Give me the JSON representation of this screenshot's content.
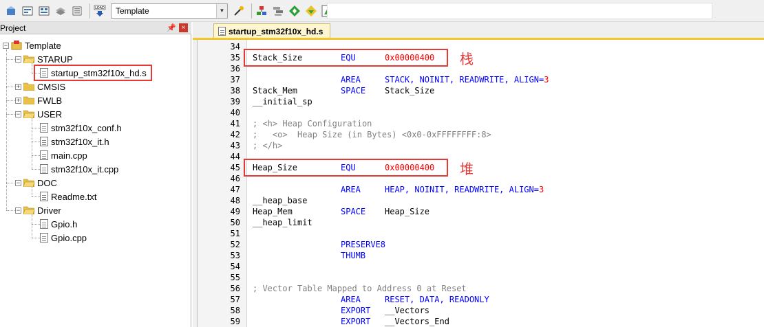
{
  "toolbar": {
    "target_combo": "Template",
    "icons": [
      "manage-components-icon",
      "options-icon",
      "options-alt-icon",
      "pack-icon",
      "batch-icon",
      "load-icon",
      "wizard-icon",
      "component-red-icon",
      "event-icon",
      "green-diamond-icon",
      "yellow-diamond-icon",
      "tree-icon"
    ]
  },
  "project": {
    "title": "Project",
    "root": "Template",
    "groups": [
      {
        "name": "STARUP",
        "expanded": true,
        "files": [
          "startup_stm32f10x_hd.s"
        ]
      },
      {
        "name": "CMSIS",
        "expanded": false,
        "files": []
      },
      {
        "name": "FWLB",
        "expanded": false,
        "files": []
      },
      {
        "name": "USER",
        "expanded": true,
        "files": [
          "stm32f10x_conf.h",
          "stm32f10x_it.h",
          "main.cpp",
          "stm32f10x_it.cpp"
        ]
      },
      {
        "name": "DOC",
        "expanded": true,
        "files": [
          "Readme.txt"
        ]
      },
      {
        "name": "Driver",
        "expanded": true,
        "files": [
          "Gpio.h",
          "Gpio.cpp"
        ]
      }
    ]
  },
  "editor": {
    "tab": "startup_stm32f10x_hd.s",
    "lines": [
      {
        "n": "34"
      },
      {
        "n": "35",
        "c1": "Stack_Size",
        "c2": "EQU",
        "hex": "0x00000400"
      },
      {
        "n": "36"
      },
      {
        "n": "37",
        "c2": "AREA",
        "c3a": "STACK, NOINIT, READWRITE, ALIGN=",
        "num": "3"
      },
      {
        "n": "38",
        "c1": "Stack_Mem",
        "c2": "SPACE",
        "c3": "Stack_Size"
      },
      {
        "n": "39",
        "c1": "__initial_sp"
      },
      {
        "n": "40"
      },
      {
        "n": "41",
        "cm": "; <h> Heap Configuration"
      },
      {
        "n": "42",
        "cm": ";   <o>  Heap Size (in Bytes) <0x0-0xFFFFFFFF:8>"
      },
      {
        "n": "43",
        "cm": "; </h>"
      },
      {
        "n": "44"
      },
      {
        "n": "45",
        "c1": "Heap_Size",
        "c2": "EQU",
        "hex": "0x00000400"
      },
      {
        "n": "46"
      },
      {
        "n": "47",
        "c2": "AREA",
        "c3a": "HEAP, NOINIT, READWRITE, ALIGN=",
        "num": "3"
      },
      {
        "n": "48",
        "c1": "__heap_base"
      },
      {
        "n": "49",
        "c1": "Heap_Mem",
        "c2": "SPACE",
        "c3": "Heap_Size"
      },
      {
        "n": "50",
        "c1": "__heap_limit"
      },
      {
        "n": "51"
      },
      {
        "n": "52",
        "c2": "PRESERVE8"
      },
      {
        "n": "53",
        "c2": "THUMB"
      },
      {
        "n": "54"
      },
      {
        "n": "55"
      },
      {
        "n": "56",
        "cm": "; Vector Table Mapped to Address 0 at Reset"
      },
      {
        "n": "57",
        "c2": "AREA",
        "c3a": "RESET, DATA, READONLY"
      },
      {
        "n": "58",
        "c2": "EXPORT",
        "c3": "__Vectors"
      },
      {
        "n": "59",
        "c2": "EXPORT",
        "c3": "__Vectors_End"
      }
    ]
  },
  "annotations": {
    "stack": "栈",
    "heap": "堆"
  },
  "colors": {
    "keyword": "#0000ff",
    "hex": "#ff0000",
    "comment": "#808080",
    "highlight_box": "#e53935",
    "tab_accent": "#f1c62f"
  }
}
